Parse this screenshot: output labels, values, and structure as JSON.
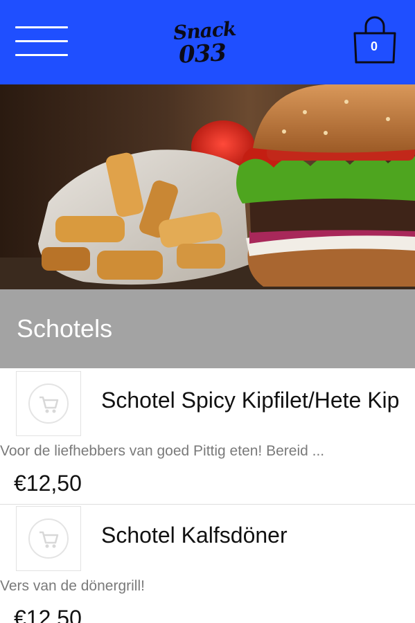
{
  "header": {
    "logo_line1": "Snack",
    "logo_line2": "033",
    "cart_count": "0",
    "colors": {
      "background": "#1f4fff",
      "logo": "#0b0b18"
    }
  },
  "category": {
    "title": "Schotels"
  },
  "items": [
    {
      "name": "Schotel Spicy Kipfilet/Hete Kip",
      "description": "Voor de liefhebbers van goed Pittig eten! Bereid ...",
      "price": "€12,50"
    },
    {
      "name": "Schotel Kalfsdöner",
      "description": "Vers van de dönergrill!",
      "price": "€12,50"
    }
  ],
  "icons": {
    "menu": "hamburger-menu-icon",
    "cart": "shopping-bag-icon",
    "add_to_cart": "cart-icon"
  }
}
